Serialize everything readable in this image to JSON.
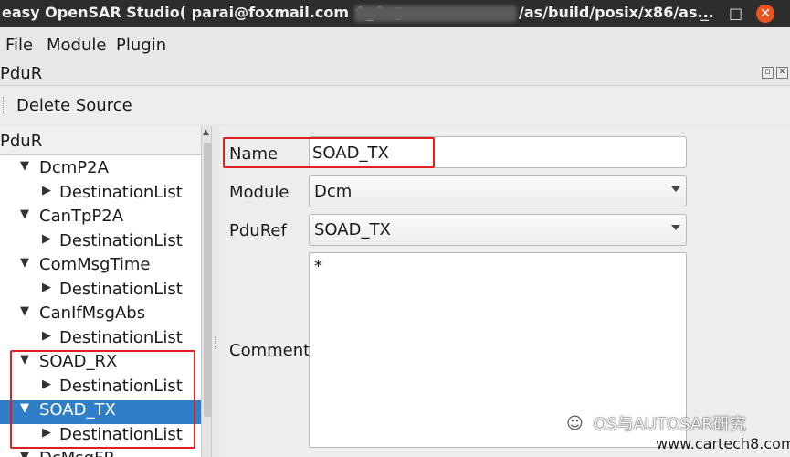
{
  "window": {
    "title_left": "easy OpenSAR Studio( parai@foxmail.com ^_^ @",
    "title_right": "/as/build/posix/x86/as...",
    "minimize_glyph": "_",
    "maximize_glyph": "□",
    "close_glyph": "✕"
  },
  "menu": {
    "file": "File",
    "module": "Module",
    "plugin": "Plugin"
  },
  "panel": {
    "title": "PduR",
    "float_glyph": "▫",
    "close_glyph": "✕"
  },
  "toolbar": {
    "delete_source": "Delete Source"
  },
  "tree": {
    "header": "PduR",
    "items": [
      {
        "label": "DcmP2A",
        "arrow": "▼"
      },
      {
        "label": "DestinationList",
        "arrow": "▶"
      },
      {
        "label": "CanTpP2A",
        "arrow": "▼"
      },
      {
        "label": "DestinationList",
        "arrow": "▶"
      },
      {
        "label": "ComMsgTime",
        "arrow": "▼"
      },
      {
        "label": "DestinationList",
        "arrow": "▶"
      },
      {
        "label": "CanIfMsgAbs",
        "arrow": "▼"
      },
      {
        "label": "DestinationList",
        "arrow": "▶"
      },
      {
        "label": "SOAD_RX",
        "arrow": "▼"
      },
      {
        "label": "DestinationList",
        "arrow": "▶"
      },
      {
        "label": "SOAD_TX",
        "arrow": "▼"
      },
      {
        "label": "DestinationList",
        "arrow": "▶"
      },
      {
        "label": "DcMsgFR",
        "arrow": "▼"
      }
    ]
  },
  "form": {
    "name_label": "Name",
    "name_value": "SOAD_TX",
    "module_label": "Module",
    "module_value": "Dcm",
    "pduref_label": "PduRef",
    "pduref_value": "SOAD_TX",
    "comment_label": "Comment",
    "comment_value": "*"
  },
  "watermark": {
    "line1": "OS与AUTOSAR研究",
    "line2": "www.cartech8.com",
    "logo": "☺"
  },
  "colors": {
    "selection": "#2f7ec7",
    "highlight_box": "#e02020",
    "titlebar": "#2d2d2d"
  }
}
